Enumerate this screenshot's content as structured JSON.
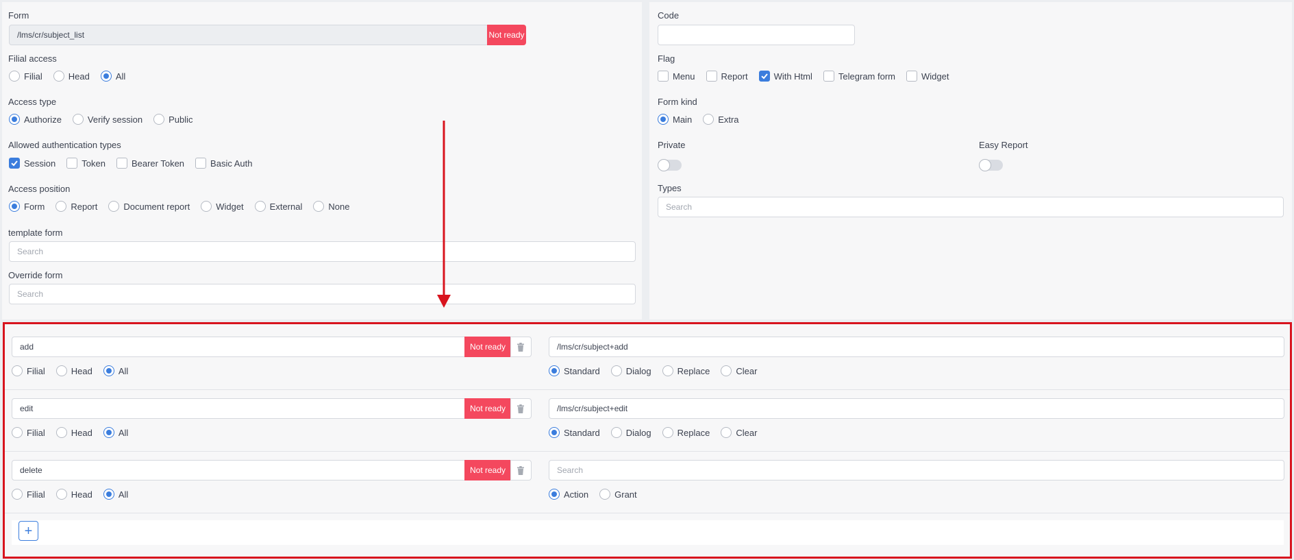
{
  "left": {
    "form": {
      "label": "Form",
      "value": "/lms/cr/subject_list",
      "status": "Not ready"
    },
    "filial_access": {
      "label": "Filial access",
      "options": [
        "Filial",
        "Head",
        "All"
      ],
      "selected": "All"
    },
    "access_type": {
      "label": "Access type",
      "options": [
        "Authorize",
        "Verify session",
        "Public"
      ],
      "selected": "Authorize"
    },
    "auth_types": {
      "label": "Allowed authentication types",
      "options": [
        "Session",
        "Token",
        "Bearer Token",
        "Basic Auth"
      ],
      "checked": [
        "Session"
      ]
    },
    "access_position": {
      "label": "Access position",
      "options": [
        "Form",
        "Report",
        "Document report",
        "Widget",
        "External",
        "None"
      ],
      "selected": "Form"
    },
    "template_form": {
      "label": "template form",
      "placeholder": "Search"
    },
    "override_form": {
      "label": "Override form",
      "placeholder": "Search"
    }
  },
  "right": {
    "code": {
      "label": "Code",
      "value": ""
    },
    "flag": {
      "label": "Flag",
      "options": [
        "Menu",
        "Report",
        "With Html",
        "Telegram form",
        "Widget"
      ],
      "checked": [
        "With Html"
      ]
    },
    "form_kind": {
      "label": "Form kind",
      "options": [
        "Main",
        "Extra"
      ],
      "selected": "Main"
    },
    "private": {
      "label": "Private",
      "on": false
    },
    "easy_report": {
      "label": "Easy Report",
      "on": false
    },
    "types": {
      "label": "Types",
      "placeholder": "Search"
    }
  },
  "actions": [
    {
      "code": "add",
      "status": "Not ready",
      "filial_options": [
        "Filial",
        "Head",
        "All"
      ],
      "filial_selected": "All",
      "target": "/lms/cr/subject+add",
      "target_placeholder": "",
      "mode_options": [
        "Standard",
        "Dialog",
        "Replace",
        "Clear"
      ],
      "mode_selected": "Standard"
    },
    {
      "code": "edit",
      "status": "Not ready",
      "filial_options": [
        "Filial",
        "Head",
        "All"
      ],
      "filial_selected": "All",
      "target": "/lms/cr/subject+edit",
      "target_placeholder": "",
      "mode_options": [
        "Standard",
        "Dialog",
        "Replace",
        "Clear"
      ],
      "mode_selected": "Standard"
    },
    {
      "code": "delete",
      "status": "Not ready",
      "filial_options": [
        "Filial",
        "Head",
        "All"
      ],
      "filial_selected": "All",
      "target": "",
      "target_placeholder": "Search",
      "mode_options": [
        "Action",
        "Grant"
      ],
      "mode_selected": "Action"
    }
  ],
  "add_button": {
    "label": "+"
  },
  "colors": {
    "accent": "#3b7ddd",
    "danger_badge": "#f4485e",
    "highlight_border": "#d8141e",
    "annotation_arrow": "#d8141e"
  }
}
